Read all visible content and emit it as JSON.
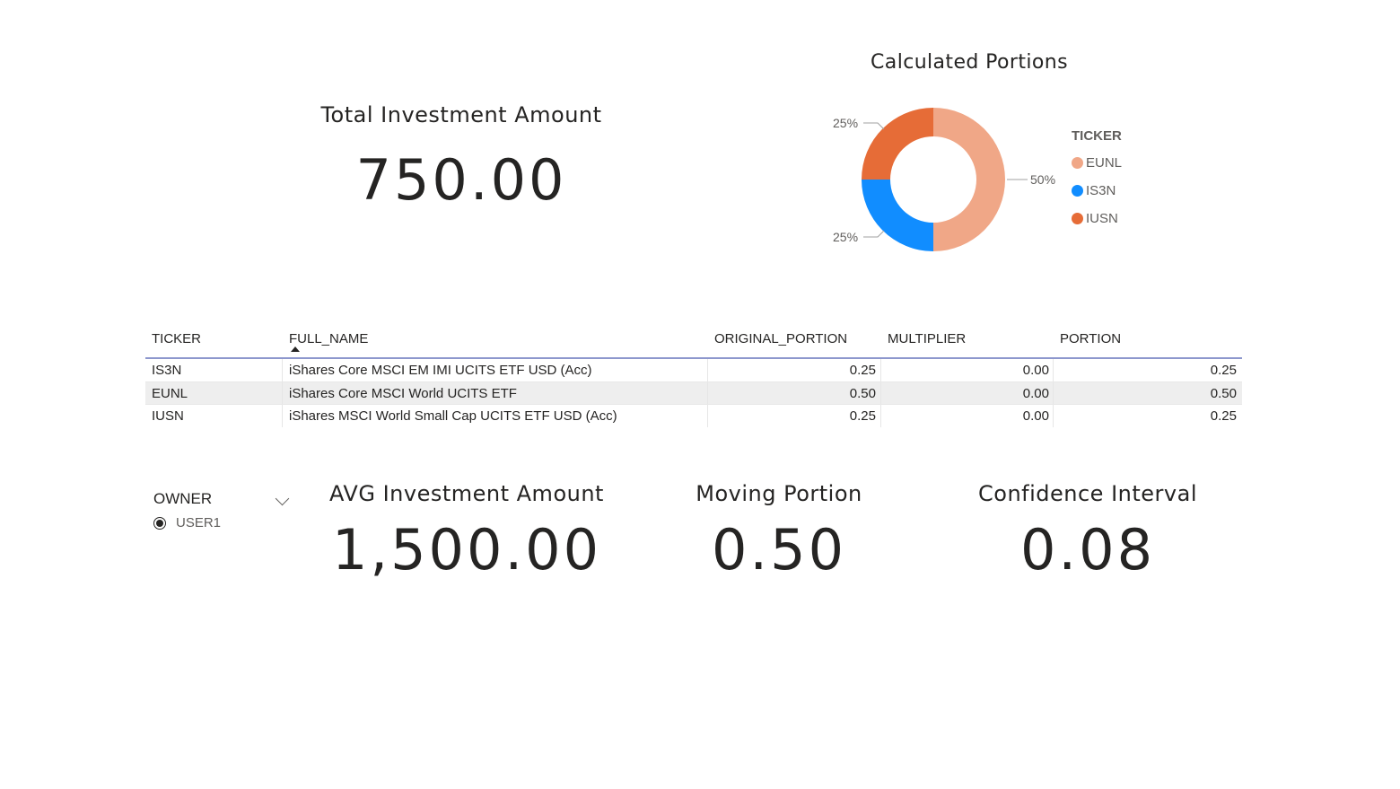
{
  "total_card": {
    "title": "Total Investment Amount",
    "value": "750.00"
  },
  "donut": {
    "title": "Calculated Portions",
    "legend_title": "TICKER",
    "legend": [
      {
        "label": "EUNL",
        "color": "#F0A787"
      },
      {
        "label": "IS3N",
        "color": "#118DFF"
      },
      {
        "label": "IUSN",
        "color": "#E66C37"
      }
    ],
    "labels": {
      "eunl": "50%",
      "is3n": "25%",
      "iusn": "25%"
    }
  },
  "chart_data": {
    "type": "pie",
    "title": "Calculated Portions",
    "legend_title": "TICKER",
    "categories": [
      "EUNL",
      "IS3N",
      "IUSN"
    ],
    "values": [
      50,
      25,
      25
    ],
    "colors": [
      "#F0A787",
      "#118DFF",
      "#E66C37"
    ],
    "legend_position": "right"
  },
  "table": {
    "headers": {
      "ticker": "TICKER",
      "full_name": "FULL_NAME",
      "original_portion": "ORIGINAL_PORTION",
      "multiplier": "MULTIPLIER",
      "portion": "PORTION"
    },
    "rows": [
      {
        "ticker": "IS3N",
        "full_name": "iShares Core MSCI EM IMI UCITS ETF USD (Acc)",
        "original_portion": "0.25",
        "multiplier": "0.00",
        "portion": "0.25"
      },
      {
        "ticker": "EUNL",
        "full_name": "iShares Core MSCI World UCITS ETF",
        "original_portion": "0.50",
        "multiplier": "0.00",
        "portion": "0.50"
      },
      {
        "ticker": "IUSN",
        "full_name": "iShares MSCI World Small Cap UCITS ETF USD (Acc)",
        "original_portion": "0.25",
        "multiplier": "0.00",
        "portion": "0.25"
      }
    ]
  },
  "slicer": {
    "title": "OWNER",
    "options": [
      {
        "label": "USER1",
        "selected": true
      }
    ]
  },
  "avg_card": {
    "title": "AVG Investment Amount",
    "value": "1,500.00"
  },
  "moving_card": {
    "title": "Moving Portion",
    "value": "0.50"
  },
  "confidence_card": {
    "title": "Confidence Interval",
    "value": "0.08"
  }
}
